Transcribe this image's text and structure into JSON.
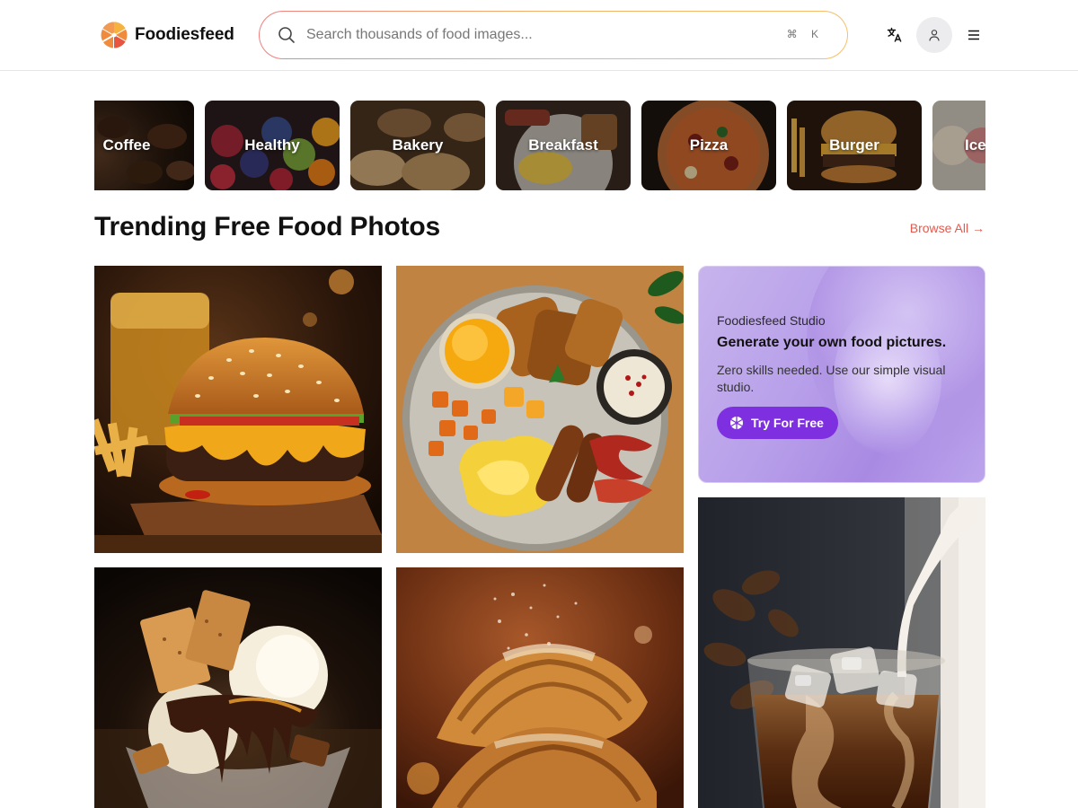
{
  "header": {
    "brand": "Foodiesfeed",
    "search_placeholder": "Search thousands of food images...",
    "shortcut_hint": "⌘ K"
  },
  "categories": [
    {
      "label": "Coffee"
    },
    {
      "label": "Healthy"
    },
    {
      "label": "Bakery"
    },
    {
      "label": "Breakfast"
    },
    {
      "label": "Pizza"
    },
    {
      "label": "Burger"
    },
    {
      "label": "Ice"
    }
  ],
  "section": {
    "title": "Trending Free Food Photos",
    "browse_all": "Browse All →"
  },
  "studio_card": {
    "eyebrow": "Foodiesfeed Studio",
    "title": "Generate your own food pictures.",
    "description": "Zero skills needed. Use our simple visual studio.",
    "button": "Try For Free"
  },
  "photos": [
    {
      "subject": "burger-with-fries-and-drink"
    },
    {
      "subject": "breakfast-plate"
    },
    {
      "subject": "ice-cream-sundae"
    },
    {
      "subject": "croissants-with-sugar"
    },
    {
      "subject": "iced-coffee-with-milk"
    }
  ],
  "colors": {
    "accent": "#e05a4f",
    "studio_button": "#7e2fe0",
    "studio_bg": "#b8a0ea"
  }
}
